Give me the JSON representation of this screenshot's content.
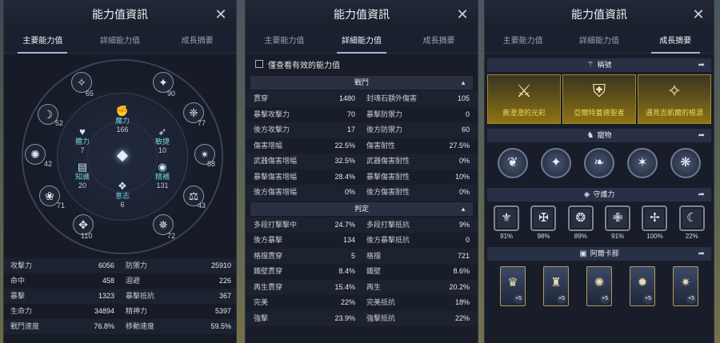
{
  "bg": {
    "accent": "#6fd3dc",
    "gold": "#f3d35a"
  },
  "panel1": {
    "title": "能力值資訊",
    "tabs": [
      "主要能力值",
      "詳細能力值",
      "成長摘要"
    ],
    "outer_values": [
      "65",
      "90",
      "52",
      "77",
      "42",
      "88",
      "71",
      "43",
      "110",
      "72"
    ],
    "inner_stats": [
      {
        "label": "魔力",
        "value": "166"
      },
      {
        "label": "體力",
        "value": "7"
      },
      {
        "label": "敏捷",
        "value": "10"
      },
      {
        "label": "知識",
        "value": "20"
      },
      {
        "label": "精補",
        "value": "131"
      },
      {
        "label": "意志",
        "value": "6"
      }
    ],
    "basic_rows": [
      {
        "l1": "攻擊力",
        "v1": "6056",
        "l2": "防禦力",
        "v2": "25910"
      },
      {
        "l1": "命中",
        "v1": "458",
        "l2": "迴避",
        "v2": "226"
      },
      {
        "l1": "暴擊",
        "v1": "1323",
        "l2": "暴擊抵抗",
        "v2": "367"
      },
      {
        "l1": "生命力",
        "v1": "34894",
        "l2": "精神力",
        "v2": "5397"
      },
      {
        "l1": "戰鬥速度",
        "v1": "76.8%",
        "l2": "移動速度",
        "v2": "59.5%"
      }
    ]
  },
  "panel2": {
    "title": "能力值資訊",
    "tabs": [
      "主要能力值",
      "詳細能力值",
      "成長摘要"
    ],
    "checkbox_label": "僅查看有效的能力值",
    "section_combat": "戰鬥",
    "combat_rows": [
      {
        "l1": "貫穿",
        "v1": "1480",
        "l2": "封魂石額外傷害",
        "v2": "105"
      },
      {
        "l1": "暴擊攻擊力",
        "v1": "70",
        "l2": "暴擊防禦力",
        "v2": "0"
      },
      {
        "l1": "後方攻擊力",
        "v1": "17",
        "l2": "後方防禦力",
        "v2": "60"
      },
      {
        "l1": "傷害增幅",
        "v1": "22.5%",
        "l2": "傷害耐性",
        "v2": "27.5%"
      },
      {
        "l1": "武器傷害增幅",
        "v1": "32.5%",
        "l2": "武器傷害耐性",
        "v2": "0%"
      },
      {
        "l1": "暴擊傷害增幅",
        "v1": "28.4%",
        "l2": "暴擊傷害耐性",
        "v2": "10%"
      },
      {
        "l1": "後方傷害增幅",
        "v1": "0%",
        "l2": "後方傷害耐性",
        "v2": "0%"
      }
    ],
    "section_judge": "判定",
    "judge_rows": [
      {
        "l1": "多段打擊擊中",
        "v1": "24.7%",
        "l2": "多段打擊抵抗",
        "v2": "9%"
      },
      {
        "l1": "後方暴擊",
        "v1": "134",
        "l2": "後方暴擊抵抗",
        "v2": "0"
      },
      {
        "l1": "格擋貫穿",
        "v1": "5",
        "l2": "格擋",
        "v2": "721"
      },
      {
        "l1": "鐵壁貫穿",
        "v1": "8.4%",
        "l2": "鐵壁",
        "v2": "8.6%"
      },
      {
        "l1": "再生貫穿",
        "v1": "15.4%",
        "l2": "再生",
        "v2": "20.2%"
      },
      {
        "l1": "完美",
        "v1": "22%",
        "l2": "完美抵抗",
        "v2": "18%"
      },
      {
        "l1": "強擊",
        "v1": "23.9%",
        "l2": "強擊抵抗",
        "v2": "22%"
      }
    ]
  },
  "panel3": {
    "title": "能力值資訊",
    "tabs": [
      "主要能力值",
      "詳細能力值",
      "成長摘要"
    ],
    "titles_header": "稱號",
    "titles": [
      "黃澄澄的光彩",
      "亞爾特蓋德聖者",
      "遇見吉凱爾的根源"
    ],
    "pets_header": "寵物",
    "guardian_header": "守護力",
    "guardian_percents": [
      "91%",
      "98%",
      "89%",
      "91%",
      "100%",
      "22%"
    ],
    "arcana_header": "阿爾卡那",
    "arcana_badge": "+5"
  }
}
